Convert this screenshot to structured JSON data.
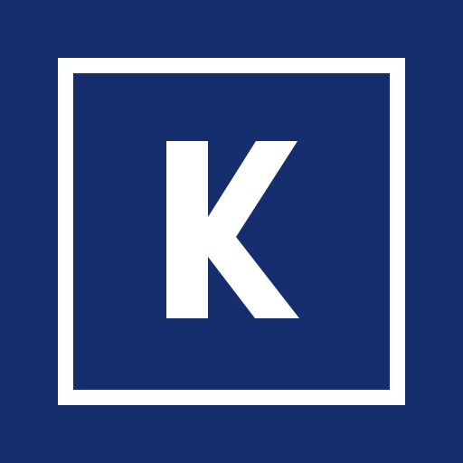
{
  "logo": {
    "letter": "K",
    "colors": {
      "background": "#162e6e",
      "foreground": "#ffffff"
    }
  }
}
